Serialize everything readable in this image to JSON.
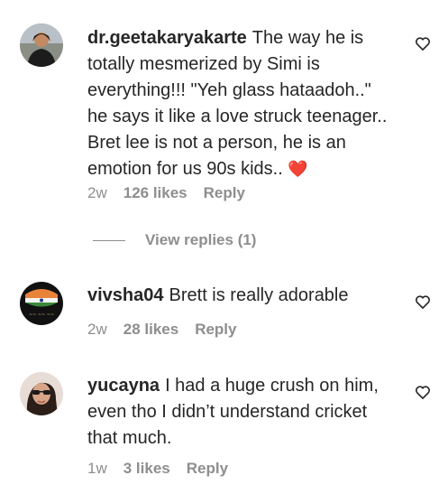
{
  "comments": [
    {
      "username": "dr.geetakaryakarte",
      "text": "The way he is totally mesmerized by Simi is everything!!! \"Yeh glass hataadoh..\" he says it like a love struck teenager.. Bret lee is not a person, he is an emotion for us 90s kids..",
      "emoji": "❤️",
      "time": "2w",
      "likes": "126 likes",
      "reply": "Reply",
      "view_replies": "View replies (1)"
    },
    {
      "username": "vivsha04",
      "text": "Brett is really adorable",
      "time": "2w",
      "likes": "28 likes",
      "reply": "Reply"
    },
    {
      "username": "yucayna",
      "text": "I had a huge crush on him, even tho I didn’t understand cricket that much.",
      "time": "1w",
      "likes": "3 likes",
      "reply": "Reply"
    }
  ]
}
